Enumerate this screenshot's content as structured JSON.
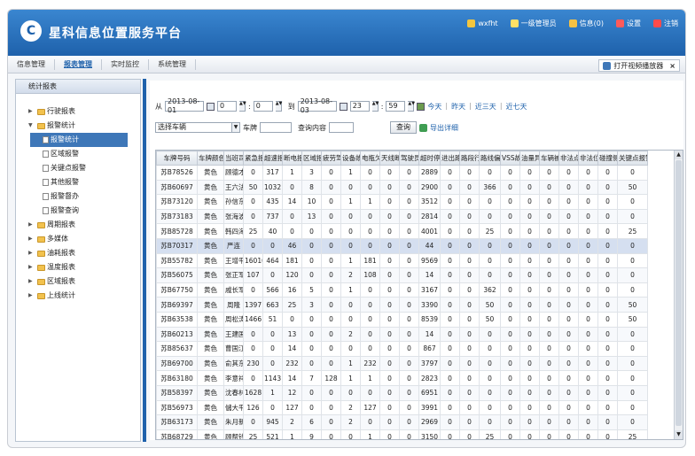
{
  "app": {
    "title": "星科信息位置服务平台",
    "logo_char": "C"
  },
  "topbar": [
    {
      "label": "wxfht",
      "icon": "user-icon",
      "color": "#f3c63f"
    },
    {
      "label": "一级管理员",
      "icon": "admin-star-icon",
      "color": "#ffe066"
    },
    {
      "label": "信息(0)",
      "icon": "mail-icon",
      "color": "#f6c244"
    },
    {
      "label": "设置",
      "icon": "heart-icon",
      "color": "#ff5a5a"
    },
    {
      "label": "注销",
      "icon": "power-icon",
      "color": "#ff4b4b"
    }
  ],
  "nav": [
    {
      "label": "信息管理",
      "active": false
    },
    {
      "label": "报表管理",
      "active": true
    },
    {
      "label": "实时监控",
      "active": false
    },
    {
      "label": "系统管理",
      "active": false
    }
  ],
  "video_button": {
    "label": "打开视频播放器",
    "close": "×"
  },
  "sidebar": {
    "title": "统计报表",
    "items": [
      {
        "label": "行驶报表",
        "type": "folder",
        "expanded": false
      },
      {
        "label": "报警统计",
        "type": "folder",
        "expanded": true
      },
      {
        "label": "报警统计",
        "type": "doc",
        "selected": true
      },
      {
        "label": "区域报警",
        "type": "doc"
      },
      {
        "label": "关键点报警",
        "type": "doc"
      },
      {
        "label": "其他报警",
        "type": "doc"
      },
      {
        "label": "报警督办",
        "type": "doc"
      },
      {
        "label": "报警查询",
        "type": "doc"
      },
      {
        "label": "周期报表",
        "type": "folder",
        "expanded": false
      },
      {
        "label": "多媒体",
        "type": "folder",
        "expanded": false
      },
      {
        "label": "油耗报表",
        "type": "folder",
        "expanded": false
      },
      {
        "label": "温度报表",
        "type": "folder",
        "expanded": false
      },
      {
        "label": "区域报表",
        "type": "folder",
        "expanded": false
      },
      {
        "label": "上线统计",
        "type": "folder",
        "expanded": false
      }
    ]
  },
  "filter": {
    "from_label": "从",
    "from_date": "2013-08-01",
    "from_hour": "0",
    "from_min": "0",
    "to_label": "到",
    "to_date": "2013-08-03",
    "to_hour": "23",
    "to_min": "59",
    "quick": [
      "今天",
      "昨天",
      "近三天",
      "近七天"
    ],
    "vehicle_select": "选择车辆",
    "plate_label": "车牌",
    "query_content_label": "查询内容",
    "query_button": "查询",
    "export_label": "导出详细"
  },
  "table": {
    "columns": [
      "车牌号码",
      "车牌颜色",
      "当班司",
      "紧急报",
      "超速报",
      "断电报",
      "区域报",
      "疲劳驾",
      "设备故",
      "电瓶欠",
      "天线断",
      "驾驶员",
      "超时停",
      "进出路",
      "路段行",
      "路线偏",
      "VSS故",
      "油量异",
      "车辆被",
      "非法点",
      "非法位",
      "碰撞侧",
      "关键点报警"
    ],
    "rows": [
      [
        "苏B78526",
        "黄色",
        "顾德才",
        "0",
        "317",
        "1",
        "3",
        "0",
        "1",
        "0",
        "0",
        "0",
        "2889",
        "0",
        "0",
        "0",
        "0",
        "0",
        "0",
        "0",
        "0",
        "0",
        "0"
      ],
      [
        "苏B60697",
        "黄色",
        "王六法",
        "50",
        "1032",
        "0",
        "8",
        "0",
        "0",
        "0",
        "0",
        "0",
        "2900",
        "0",
        "0",
        "366",
        "0",
        "0",
        "0",
        "0",
        "0",
        "0",
        "50"
      ],
      [
        "苏B73120",
        "黄色",
        "孙信东",
        "0",
        "435",
        "14",
        "10",
        "0",
        "1",
        "1",
        "0",
        "0",
        "3512",
        "0",
        "0",
        "0",
        "0",
        "0",
        "0",
        "0",
        "0",
        "0",
        "0"
      ],
      [
        "苏B73183",
        "黄色",
        "张海波",
        "0",
        "737",
        "0",
        "13",
        "0",
        "0",
        "0",
        "0",
        "0",
        "2814",
        "0",
        "0",
        "0",
        "0",
        "0",
        "0",
        "0",
        "0",
        "0",
        "0"
      ],
      [
        "苏B85728",
        "黄色",
        "韩四海",
        "25",
        "40",
        "0",
        "0",
        "0",
        "0",
        "0",
        "0",
        "0",
        "4001",
        "0",
        "0",
        "25",
        "0",
        "0",
        "0",
        "0",
        "0",
        "0",
        "25"
      ],
      [
        "苏B70317",
        "黄色",
        "严连",
        "0",
        "0",
        "46",
        "0",
        "0",
        "0",
        "0",
        "0",
        "0",
        "44",
        "0",
        "0",
        "0",
        "0",
        "0",
        "0",
        "0",
        "0",
        "0",
        "0"
      ],
      [
        "苏B55782",
        "黄色",
        "王增平",
        "16010",
        "464",
        "181",
        "0",
        "0",
        "1",
        "181",
        "0",
        "0",
        "9569",
        "0",
        "0",
        "0",
        "0",
        "0",
        "0",
        "0",
        "0",
        "0",
        "0"
      ],
      [
        "苏B56075",
        "黄色",
        "张正军",
        "107",
        "0",
        "120",
        "0",
        "0",
        "2",
        "108",
        "0",
        "0",
        "14",
        "0",
        "0",
        "0",
        "0",
        "0",
        "0",
        "0",
        "0",
        "0",
        "0"
      ],
      [
        "苏B67750",
        "黄色",
        "戚长军",
        "0",
        "566",
        "16",
        "5",
        "0",
        "1",
        "0",
        "0",
        "0",
        "3167",
        "0",
        "0",
        "362",
        "0",
        "0",
        "0",
        "0",
        "0",
        "0",
        "0"
      ],
      [
        "苏B69397",
        "黄色",
        "周隆",
        "1397",
        "663",
        "25",
        "3",
        "0",
        "0",
        "0",
        "0",
        "0",
        "3390",
        "0",
        "0",
        "50",
        "0",
        "0",
        "0",
        "0",
        "0",
        "0",
        "50"
      ],
      [
        "苏B63538",
        "黄色",
        "周松涛",
        "1466",
        "51",
        "0",
        "0",
        "0",
        "0",
        "0",
        "0",
        "0",
        "8539",
        "0",
        "0",
        "50",
        "0",
        "0",
        "0",
        "0",
        "0",
        "0",
        "50"
      ],
      [
        "苏B60213",
        "黄色",
        "王建国",
        "0",
        "0",
        "13",
        "0",
        "0",
        "2",
        "0",
        "0",
        "0",
        "14",
        "0",
        "0",
        "0",
        "0",
        "0",
        "0",
        "0",
        "0",
        "0",
        "0"
      ],
      [
        "苏B85637",
        "黄色",
        "曹国江",
        "0",
        "0",
        "14",
        "0",
        "0",
        "0",
        "0",
        "0",
        "0",
        "867",
        "0",
        "0",
        "0",
        "0",
        "0",
        "0",
        "0",
        "0",
        "0",
        "0"
      ],
      [
        "苏B69700",
        "黄色",
        "俞其东",
        "230",
        "0",
        "232",
        "0",
        "0",
        "1",
        "232",
        "0",
        "0",
        "3797",
        "0",
        "0",
        "0",
        "0",
        "0",
        "0",
        "0",
        "0",
        "0",
        "0"
      ],
      [
        "苏B63180",
        "黄色",
        "李意祥",
        "0",
        "1143",
        "14",
        "7",
        "128",
        "1",
        "1",
        "0",
        "0",
        "2823",
        "0",
        "0",
        "0",
        "0",
        "0",
        "0",
        "0",
        "0",
        "0",
        "0"
      ],
      [
        "苏B58397",
        "黄色",
        "沈春林",
        "1628",
        "1",
        "12",
        "0",
        "0",
        "0",
        "0",
        "0",
        "0",
        "6951",
        "0",
        "0",
        "0",
        "0",
        "0",
        "0",
        "0",
        "0",
        "0",
        "0"
      ],
      [
        "苏B56973",
        "黄色",
        "儲大平",
        "126",
        "0",
        "127",
        "0",
        "0",
        "2",
        "127",
        "0",
        "0",
        "3991",
        "0",
        "0",
        "0",
        "0",
        "0",
        "0",
        "0",
        "0",
        "0",
        "0"
      ],
      [
        "苏B63173",
        "黄色",
        "朱月新",
        "0",
        "945",
        "2",
        "6",
        "0",
        "2",
        "0",
        "0",
        "0",
        "2969",
        "0",
        "0",
        "0",
        "0",
        "0",
        "0",
        "0",
        "0",
        "0",
        "0"
      ],
      [
        "苏B68729",
        "黄色",
        "顾帮钱",
        "25",
        "521",
        "1",
        "9",
        "0",
        "0",
        "1",
        "0",
        "0",
        "3150",
        "0",
        "0",
        "25",
        "0",
        "0",
        "0",
        "0",
        "0",
        "0",
        "25"
      ]
    ],
    "highlight_row": 5
  }
}
